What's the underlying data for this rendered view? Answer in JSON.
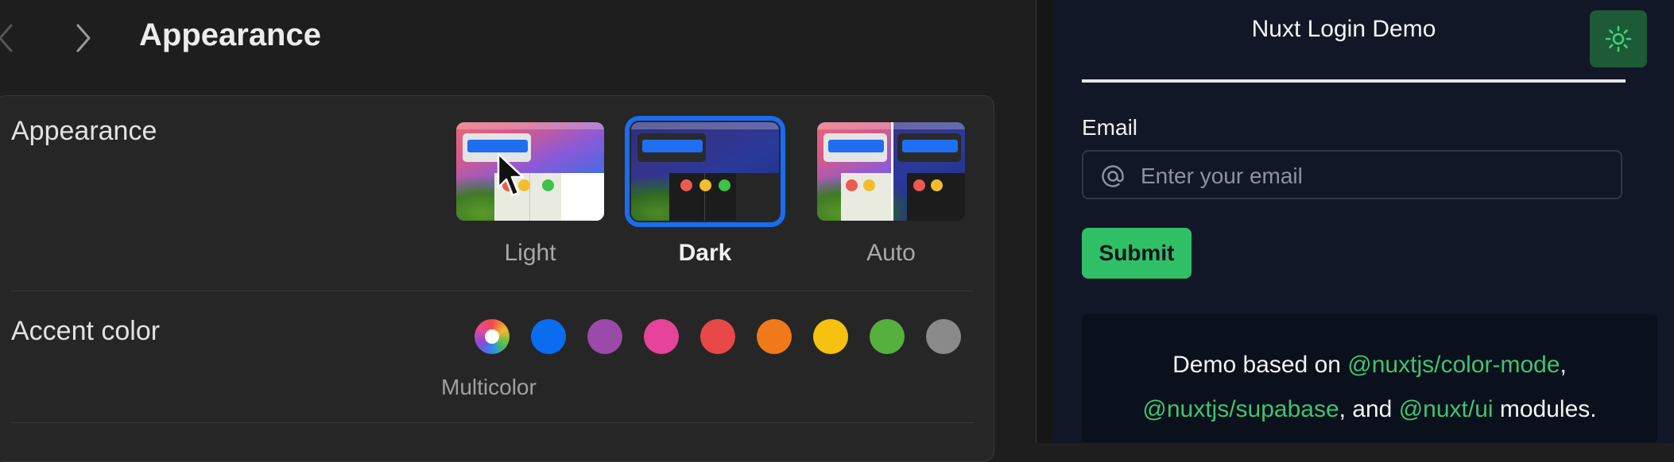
{
  "settings": {
    "title": "Appearance",
    "appearance_row": {
      "label": "Appearance",
      "options": [
        {
          "label": "Light",
          "selected": false
        },
        {
          "label": "Dark",
          "selected": true
        },
        {
          "label": "Auto",
          "selected": false
        }
      ]
    },
    "accent_row": {
      "label": "Accent color",
      "selected_name": "Multicolor",
      "swatches": [
        {
          "name": "multicolor",
          "color": "multicolor"
        },
        {
          "name": "blue",
          "color": "#0a6cf0"
        },
        {
          "name": "purple",
          "color": "#9a4aa8"
        },
        {
          "name": "pink",
          "color": "#e6449a"
        },
        {
          "name": "red",
          "color": "#e94848"
        },
        {
          "name": "orange",
          "color": "#f07a1a"
        },
        {
          "name": "yellow",
          "color": "#f6c20f"
        },
        {
          "name": "green",
          "color": "#55b03e"
        },
        {
          "name": "graphite",
          "color": "#8a8a8a"
        }
      ]
    }
  },
  "nuxt": {
    "title": "Nuxt Login Demo",
    "toggle_icon": "sun-icon",
    "email_label": "Email",
    "email_placeholder": "Enter your email",
    "email_value": "",
    "submit_label": "Submit",
    "info": {
      "prefix": "Demo based on ",
      "module1": "@nuxtjs/color-mode",
      "sep1": ",",
      "module2": "@nuxtjs/supabase",
      "sep2": ", and ",
      "module3": "@nuxt/ui",
      "suffix": " modules."
    },
    "colors": {
      "accent": "#3fc46f",
      "background": "#111726",
      "button": "#2fc066"
    }
  }
}
